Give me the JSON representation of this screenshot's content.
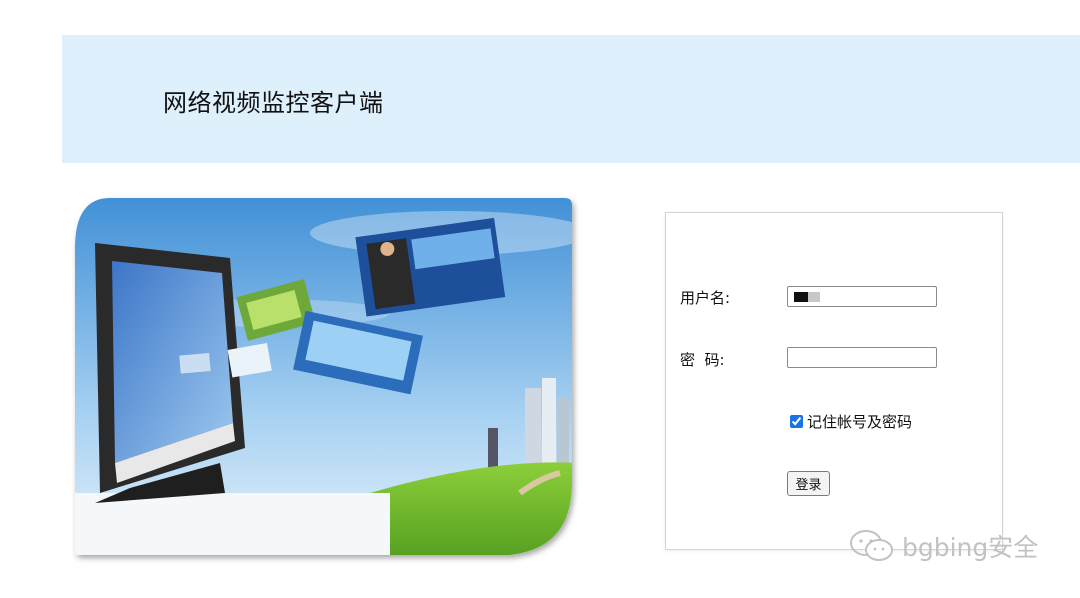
{
  "header": {
    "title": "网络视频监控客户端",
    "background_color": "#def0fc"
  },
  "hero": {
    "image": "monitor-with-flying-photos-illustration",
    "alt": ""
  },
  "login": {
    "username_label": "用户名:",
    "username_value": "",
    "password_label": "密  码:",
    "password_value": "",
    "remember_label": "记住帐号及密码",
    "remember_checked": true,
    "submit_label": "登录"
  },
  "watermark": {
    "text": "bgbing安全",
    "icon": "wechat-icon"
  }
}
